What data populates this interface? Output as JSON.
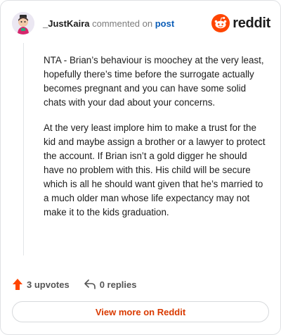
{
  "comment": {
    "author": "_JustKaira",
    "action_text": "commented on",
    "post_link": "post",
    "paragraphs": [
      "NTA - Brian’s behaviour is moochey at the very least, hopefully there’s time before the surrogate actually becomes pregnant and you can have some solid chats with your dad about your concerns.",
      "At the very least implore him to make a trust for the kid and maybe assign a brother or a lawyer to protect the account. If Brian isn’t a gold digger he should have no problem with this. His child will be secure which is all he should want given that he’s married to a much older man whose life expectancy may not make it to the kids graduation."
    ]
  },
  "brand": {
    "wordmark": "reddit",
    "color": "#ff4500"
  },
  "actions": {
    "upvotes": "3 upvotes",
    "replies": "0 replies",
    "upvote_icon": "upvote-arrow-icon",
    "reply_icon": "reply-arrow-icon"
  },
  "view_more": {
    "label": "View more on Reddit",
    "color": "#d93a00"
  }
}
